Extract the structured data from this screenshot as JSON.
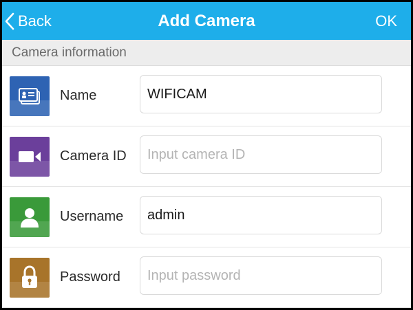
{
  "navbar": {
    "back_label": "Back",
    "title": "Add Camera",
    "ok_label": "OK",
    "color": "#1eaeea"
  },
  "section": {
    "title": "Camera information"
  },
  "fields": [
    {
      "label": "Name",
      "value": "WIFICAM",
      "placeholder": "",
      "icon": "name-card-icon",
      "color": "#2e63b3"
    },
    {
      "label": "Camera ID",
      "value": "",
      "placeholder": "Input camera ID",
      "icon": "video-camera-icon",
      "color": "#6b3f9b"
    },
    {
      "label": "Username",
      "value": "admin",
      "placeholder": "",
      "icon": "user-icon",
      "color": "#3a9a3a"
    },
    {
      "label": "Password",
      "value": "",
      "placeholder": "Input password",
      "icon": "lock-icon",
      "color": "#a8742a"
    }
  ]
}
